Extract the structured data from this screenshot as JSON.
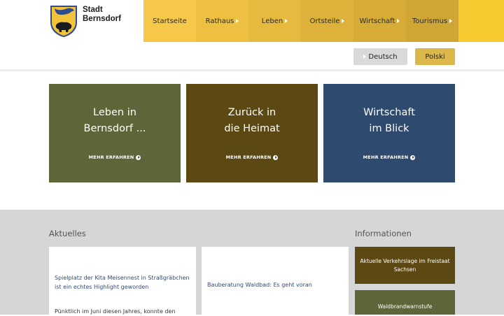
{
  "header": {
    "logo_line1": "Stadt",
    "logo_line2": "Bernsdorf"
  },
  "nav": {
    "items": [
      {
        "label": "Startseite",
        "color": "#f5c84a",
        "has_arrow": false
      },
      {
        "label": "Rathaus",
        "color": "#edc042",
        "has_arrow": true
      },
      {
        "label": "Leben",
        "color": "#e6ba3e",
        "has_arrow": true
      },
      {
        "label": "Ortsteile",
        "color": "#deb23a",
        "has_arrow": true
      },
      {
        "label": "Wirtschaft",
        "color": "#d6ab36",
        "has_arrow": true
      },
      {
        "label": "Tourismus",
        "color": "#cfa533",
        "has_arrow": true
      }
    ],
    "fill_color": "#f7ca32"
  },
  "languages": {
    "de": "Deutsch",
    "pl": "Polski"
  },
  "tiles": [
    {
      "line1": "Leben in",
      "line2": "Bernsdorf ...",
      "more": "MEHR ERFAHREN"
    },
    {
      "line1": "Zurück in",
      "line2": "die Heimat",
      "more": "MEHR ERFAHREN"
    },
    {
      "line1": "Wirtschaft",
      "line2": "im Blick",
      "more": "MEHR ERFAHREN"
    }
  ],
  "news_section": {
    "heading": "Aktuelles",
    "items": [
      {
        "title": "Spielplatz der Kita Meisennest in Straßgräbchen ist ein echtes Highlight geworden",
        "text": "Pünktlich im Juni diesen Jahres, konnte den"
      },
      {
        "title": "Bauberatung Waldbad: Es geht voran",
        "text": ""
      }
    ]
  },
  "info_section": {
    "heading": "Informationen",
    "items": [
      {
        "label": "Aktuelle Verkehrslage im Freistaat Sachsen"
      },
      {
        "label": "Waldbrandwarnstufe"
      }
    ]
  },
  "colors": {
    "accent_yellow": "#f5c84a",
    "olive": "#5c6638",
    "brown": "#5b4812",
    "navy": "#2e4a6e",
    "link_blue": "#2f4c74"
  }
}
